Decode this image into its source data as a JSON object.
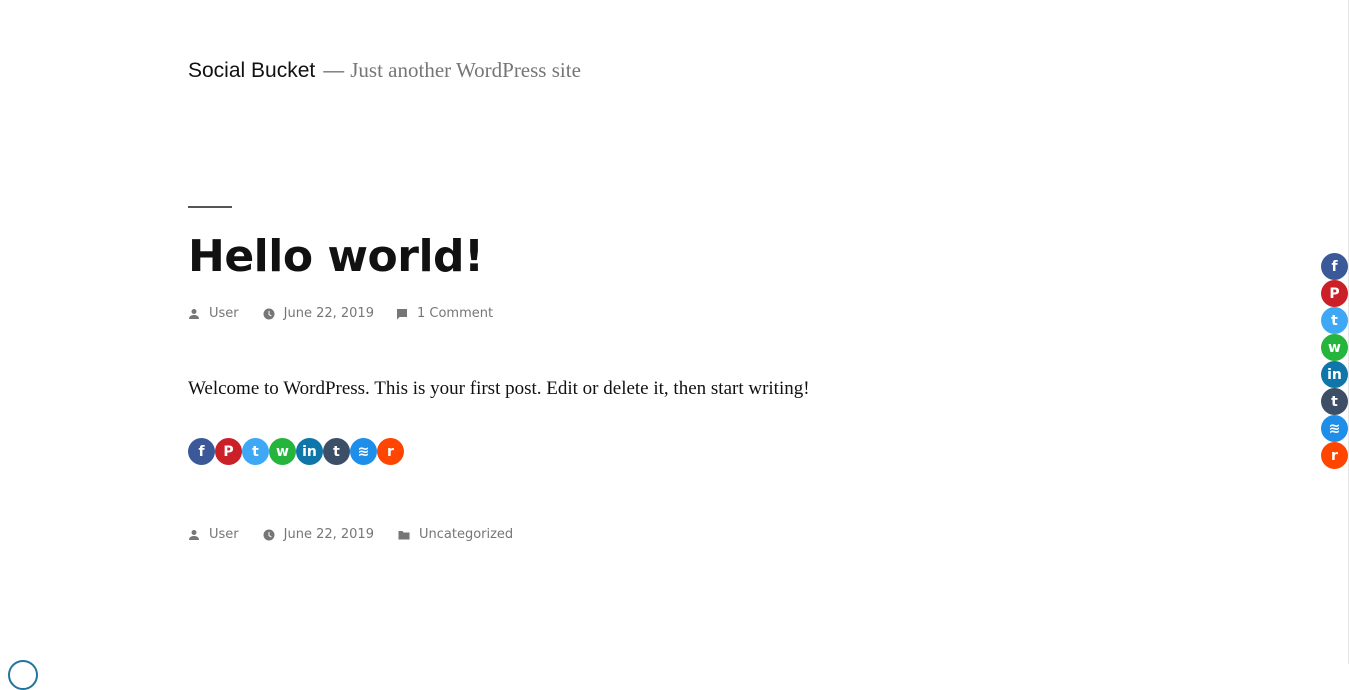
{
  "header": {
    "site_title": "Social Bucket",
    "separator": "—",
    "tagline": "Just another WordPress site"
  },
  "post": {
    "title": "Hello world!",
    "meta_top": {
      "author": "User",
      "date": "June 22, 2019",
      "comments": "1 Comment"
    },
    "content": "Welcome to WordPress. This is your first post. Edit or delete it, then start writing!",
    "meta_bottom": {
      "author": "User",
      "date": "June 22, 2019",
      "category": "Uncategorized"
    }
  },
  "share_buttons": [
    {
      "name": "facebook",
      "glyph": "f",
      "color": "#3b5998",
      "icon": "facebook-icon"
    },
    {
      "name": "pinterest",
      "glyph": "P",
      "color": "#cb2027",
      "icon": "pinterest-icon"
    },
    {
      "name": "twitter",
      "glyph": "t",
      "color": "#3ea8f5",
      "icon": "twitter-icon"
    },
    {
      "name": "whatsapp",
      "glyph": "w",
      "color": "#25b43c",
      "icon": "whatsapp-icon"
    },
    {
      "name": "linkedin",
      "glyph": "in",
      "color": "#0e76a8",
      "icon": "linkedin-icon"
    },
    {
      "name": "tumblr",
      "glyph": "t",
      "color": "#3d4f67",
      "icon": "tumblr-icon"
    },
    {
      "name": "buffer",
      "glyph": "≋",
      "color": "#1e8ee8",
      "icon": "buffer-icon"
    },
    {
      "name": "reddit",
      "glyph": "r",
      "color": "#ff4500",
      "icon": "reddit-icon"
    }
  ]
}
